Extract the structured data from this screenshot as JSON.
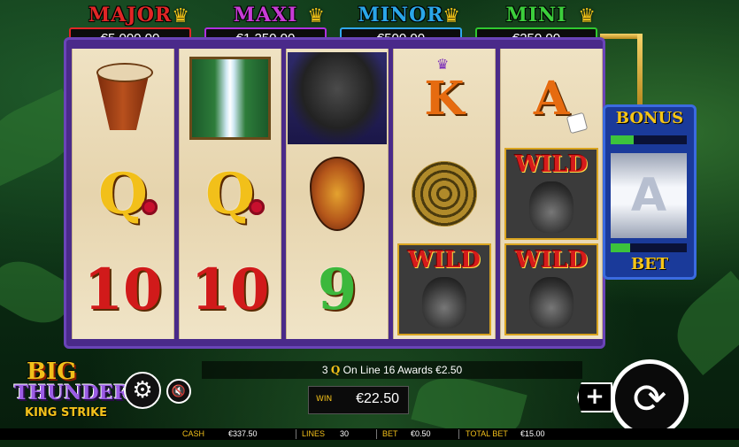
{
  "jackpots": [
    {
      "name": "MAJOR",
      "value": "€5,000.00",
      "color": "#e02626",
      "border": "#e02626"
    },
    {
      "name": "MAXI",
      "value": "€1,250.00",
      "color": "#c83cd6",
      "border": "#b030e0"
    },
    {
      "name": "MINOR",
      "value": "€500.00",
      "color": "#2aa6e8",
      "border": "#30a8f0"
    },
    {
      "name": "MINI",
      "value": "€250.00",
      "color": "#3ccf3c",
      "border": "#30c830"
    }
  ],
  "reels": [
    [
      "drum-icon",
      "Q",
      "10"
    ],
    [
      "waterfall-icon",
      "Q",
      "10"
    ],
    [
      "gorilla-icon",
      "shield-icon",
      "9"
    ],
    [
      "K",
      "snake-icon",
      "WILD"
    ],
    [
      "A",
      "WILD",
      "WILD"
    ]
  ],
  "symbols": {
    "wild": "WILD",
    "q": "Q",
    "k": "K",
    "a": "A",
    "ten": "10",
    "nine": "9"
  },
  "bonus": {
    "title": "BONUS",
    "bet_label": "BET",
    "reel_symbol": "A",
    "top_fill": 0.3,
    "bottom_fill": 0.25
  },
  "message": {
    "count": "3",
    "symbol": "Q",
    "text": "On Line 16 Awards €2.50"
  },
  "win": {
    "label": "WIN",
    "value": "€22.50"
  },
  "logo": {
    "line1": "BIG",
    "line2": "THUNDER",
    "line3": "KING STRIKE"
  },
  "status": {
    "cash_label": "CASH",
    "cash_value": "€337.50",
    "lines_label": "LINES",
    "lines_value": "30",
    "bet_label": "BET",
    "bet_value": "€0.50",
    "total_bet_label": "TOTAL BET",
    "total_bet_value": "€15.00"
  },
  "icons": {
    "settings": "gear-icon",
    "sound": "speaker-mute-icon",
    "spin": "spin-arrows-icon",
    "plus": "plus-icon"
  }
}
